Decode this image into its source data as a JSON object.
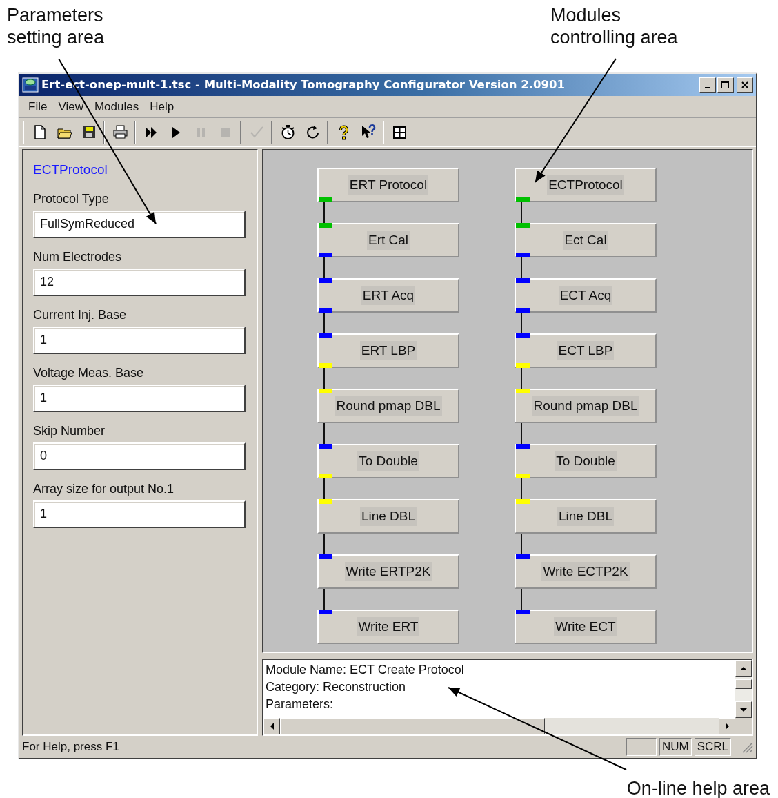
{
  "annotations": [
    {
      "text": "Parameters setting area"
    },
    {
      "text": "Modules controlling area"
    },
    {
      "text": "On-line help area"
    }
  ],
  "window": {
    "title": "Ert-ect-onep-mult-1.tsc - Multi-Modality Tomography Configurator Version 2.0901"
  },
  "menu": [
    "File",
    "View",
    "Modules",
    "Help"
  ],
  "toolbar": [
    [
      {
        "disabled": false
      },
      {
        "disabled": false
      },
      {
        "disabled": false
      }
    ],
    [
      {
        "disabled": false
      }
    ],
    [
      {
        "disabled": false
      },
      {
        "disabled": false
      },
      {
        "disabled": true
      },
      {
        "disabled": true
      }
    ],
    [
      {
        "disabled": true
      }
    ],
    [
      {
        "disabled": false
      },
      {
        "disabled": false
      }
    ],
    [
      {
        "disabled": false
      },
      {
        "disabled": false
      }
    ],
    [
      {
        "disabled": false
      }
    ]
  ],
  "parameters": {
    "module": "ECTProtocol",
    "fields": [
      {
        "label": "Protocol Type",
        "value": "FullSymReduced"
      },
      {
        "label": "Num Electrodes",
        "value": "12"
      },
      {
        "label": "Current Inj. Base",
        "value": "1"
      },
      {
        "label": "Voltage Meas. Base",
        "value": "1"
      },
      {
        "label": "Skip Number",
        "value": "0"
      },
      {
        "label": "Array size for output No.1",
        "value": "1"
      }
    ]
  },
  "module_columns": [
    {
      "modules": [
        {
          "label": "ERT Protocol",
          "ports": [
            {
              "kind": "output",
              "color": "#00c000"
            }
          ]
        },
        {
          "label": "Ert Cal",
          "ports": [
            {
              "kind": "input",
              "color": "#00c000"
            },
            {
              "kind": "output",
              "color": "#0000ff"
            }
          ]
        },
        {
          "label": "ERT Acq",
          "ports": [
            {
              "kind": "input",
              "color": "#0000ff"
            },
            {
              "kind": "output",
              "color": "#0000ff"
            }
          ]
        },
        {
          "label": "ERT LBP",
          "ports": [
            {
              "kind": "input",
              "color": "#0000ff"
            },
            {
              "kind": "output",
              "color": "#ffff00"
            }
          ]
        },
        {
          "label": "Round pmap DBL",
          "ports": [
            {
              "kind": "input",
              "color": "#ffff00"
            }
          ]
        },
        {
          "label": "To Double",
          "ports": [
            {
              "kind": "input",
              "color": "#0000ff"
            },
            {
              "kind": "output",
              "color": "#ffff00"
            }
          ]
        },
        {
          "label": "Line DBL",
          "ports": [
            {
              "kind": "input",
              "color": "#ffff00"
            }
          ]
        },
        {
          "label": "Write ERTP2K",
          "ports": [
            {
              "kind": "input",
              "color": "#0000ff"
            }
          ]
        },
        {
          "label": "Write ERT",
          "ports": [
            {
              "kind": "input",
              "color": "#0000ff"
            }
          ]
        }
      ]
    },
    {
      "modules": [
        {
          "label": "ECTProtocol",
          "ports": [
            {
              "kind": "output",
              "color": "#00c000"
            }
          ]
        },
        {
          "label": "Ect Cal",
          "ports": [
            {
              "kind": "input",
              "color": "#00c000"
            },
            {
              "kind": "output",
              "color": "#0000ff"
            }
          ]
        },
        {
          "label": "ECT Acq",
          "ports": [
            {
              "kind": "input",
              "color": "#0000ff"
            },
            {
              "kind": "output",
              "color": "#0000ff"
            }
          ]
        },
        {
          "label": "ECT LBP",
          "ports": [
            {
              "kind": "input",
              "color": "#0000ff"
            },
            {
              "kind": "output",
              "color": "#ffff00"
            }
          ]
        },
        {
          "label": "Round pmap DBL",
          "ports": [
            {
              "kind": "input",
              "color": "#ffff00"
            }
          ]
        },
        {
          "label": "To Double",
          "ports": [
            {
              "kind": "input",
              "color": "#0000ff"
            },
            {
              "kind": "output",
              "color": "#ffff00"
            }
          ]
        },
        {
          "label": "Line DBL",
          "ports": [
            {
              "kind": "input",
              "color": "#ffff00"
            }
          ]
        },
        {
          "label": "Write ECTP2K",
          "ports": [
            {
              "kind": "input",
              "color": "#0000ff"
            }
          ]
        },
        {
          "label": "Write ECT",
          "ports": [
            {
              "kind": "input",
              "color": "#0000ff"
            }
          ]
        }
      ]
    }
  ],
  "help": {
    "lines": [
      "Module Name: ECT Create Protocol",
      "Category: Reconstruction",
      "Parameters:"
    ]
  },
  "status_bar": {
    "text": "For Help, press F1",
    "indicators": [
      "NUM",
      "SCRL"
    ]
  }
}
